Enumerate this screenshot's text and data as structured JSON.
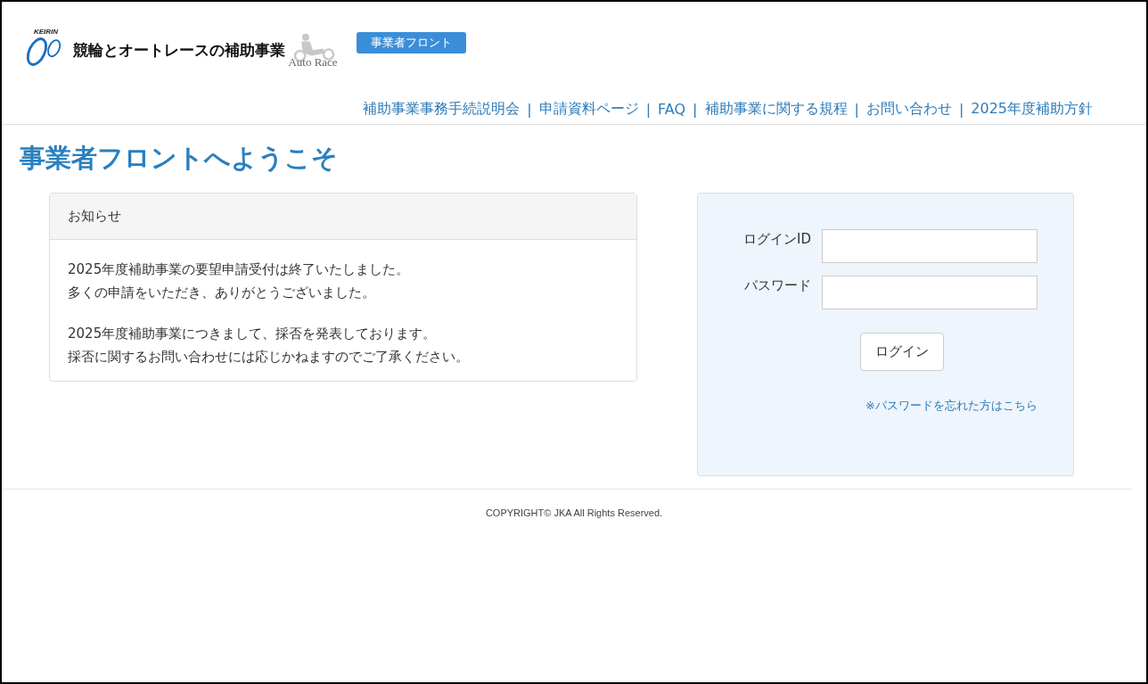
{
  "header": {
    "logo": {
      "kicker": "KEIRIN",
      "title": "競輪とオートレースの補助事業",
      "subtitle": "Auto Race"
    },
    "badge": "事業者フロント"
  },
  "nav": {
    "links": [
      "補助事業事務手続説明会",
      "申請資料ページ",
      "FAQ",
      "補助事業に関する規程",
      "お問い合わせ",
      "2025年度補助方針"
    ],
    "separators": [
      "|",
      "|",
      "|",
      "|",
      "|"
    ]
  },
  "heading": "事業者フロントへようこそ",
  "notice": {
    "title": "お知らせ",
    "paragraphs": [
      [
        "2025年度補助事業の要望申請受付は終了いたしました。",
        "多くの申請をいただき、ありがとうございました。"
      ],
      [
        "2025年度補助事業につきまして、採否を発表しております。",
        "採否に関するお問い合わせには応じかねますのでご了承ください。"
      ]
    ]
  },
  "login": {
    "fields": [
      {
        "label": "ログインID"
      },
      {
        "label": "パスワード"
      }
    ],
    "button": "ログイン",
    "forgot_link": "※パスワードを忘れた方はこちら"
  },
  "footer": "COPYRIGHT© JKA All Rights Reserved."
}
